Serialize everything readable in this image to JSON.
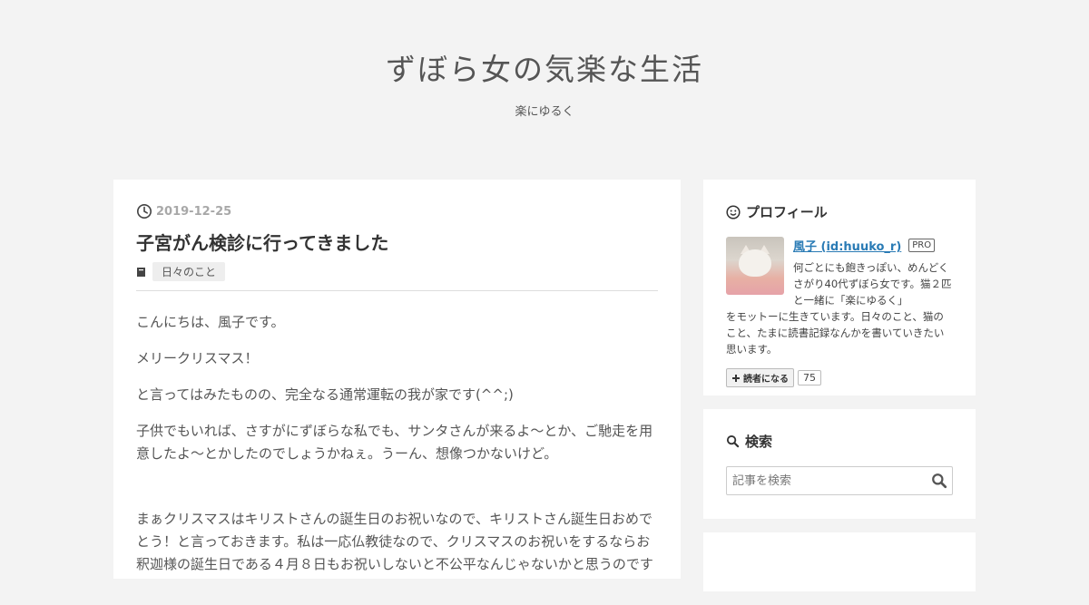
{
  "blog": {
    "title": "ずぼら女の気楽な生活",
    "description": "楽にゆるく"
  },
  "entry": {
    "date": "2019-12-25",
    "title": "子宮がん検診に行ってきました",
    "category": "日々のこと",
    "paragraphs": [
      "こんにちは、風子です。",
      "メリークリスマス！",
      "と言ってはみたものの、完全なる通常運転の我が家です(^^;)",
      "子供でもいれば、さすがにずぼらな私でも、サンタさんが来るよ～とか、ご馳走を用意したよ～とかしたのでしょうかねぇ。うーん、想像つかないけど。",
      "まぁクリスマスはキリストさんの誕生日のお祝いなので、キリストさん誕生日おめでとう！と言っておきます。私は一応仏教徒なので、クリスマスのお祝いをするならお釈迦様の誕生日である４月８日もお祝いしないと不公平なんじゃないかと思うのです"
    ]
  },
  "sidebar": {
    "profile": {
      "heading": "プロフィール",
      "name": "風子 (id:huuko_r)",
      "badge": "PRO",
      "bio_side": "何ごとにも飽きっぽい、めんどくさがり40代ずぼら女です。猫２匹と一緒に「楽にゆるく」",
      "bio_full": "をモットーに生きています。日々のこと、猫のこと、たまに読書記録なんかを書いていきたい思います。",
      "reader_button": "読者になる",
      "reader_count": "75"
    },
    "search": {
      "heading": "検索",
      "placeholder": "記事を検索"
    }
  }
}
